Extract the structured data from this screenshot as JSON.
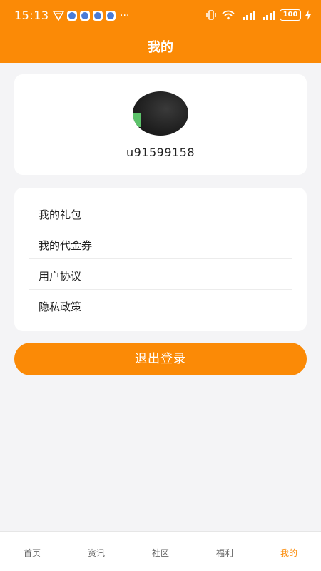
{
  "status_bar": {
    "time": "15:13",
    "battery": "100",
    "more": "···"
  },
  "header": {
    "title": "我的"
  },
  "profile": {
    "username": "u91599158"
  },
  "menu": {
    "items": [
      {
        "label": "我的礼包"
      },
      {
        "label": "我的代金券"
      },
      {
        "label": "用户协议"
      },
      {
        "label": "隐私政策"
      }
    ]
  },
  "logout": {
    "label": "退出登录"
  },
  "tabbar": {
    "tabs": [
      {
        "label": "首页",
        "active": false
      },
      {
        "label": "资讯",
        "active": false
      },
      {
        "label": "社区",
        "active": false
      },
      {
        "label": "福利",
        "active": false
      },
      {
        "label": "我的",
        "active": true
      }
    ]
  },
  "colors": {
    "accent": "#fb8a06",
    "background": "#f4f4f6"
  }
}
